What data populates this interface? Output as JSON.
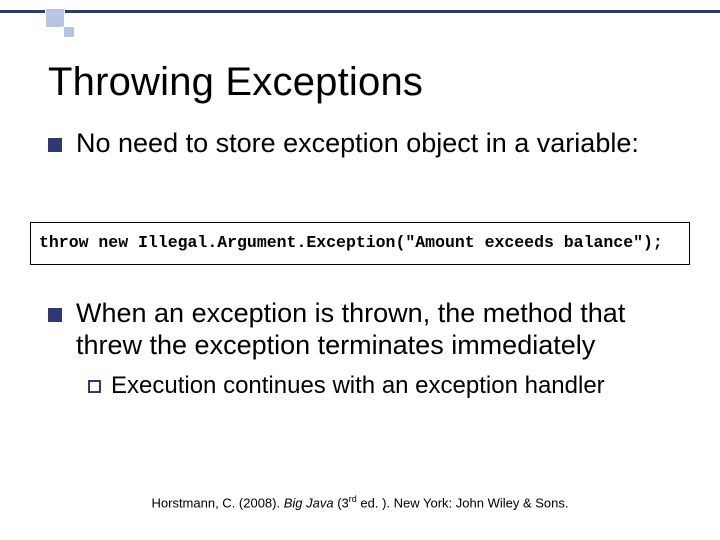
{
  "title": "Throwing Exceptions",
  "bullets": {
    "b1": "No need to store exception object in a variable:",
    "b2": "When an exception is thrown, the method that threw the exception terminates immediately",
    "b2_sub": "Execution continues with an exception handler"
  },
  "code": "throw new Illegal.Argument.Exception(\"Amount exceeds balance\");",
  "citation": {
    "author": "Horstmann, C. (2008). ",
    "title_italic": "Big Java ",
    "edition_pre": "(3",
    "edition_ord": "rd",
    "edition_post": " ed. ). New York: John Wiley & Sons."
  }
}
